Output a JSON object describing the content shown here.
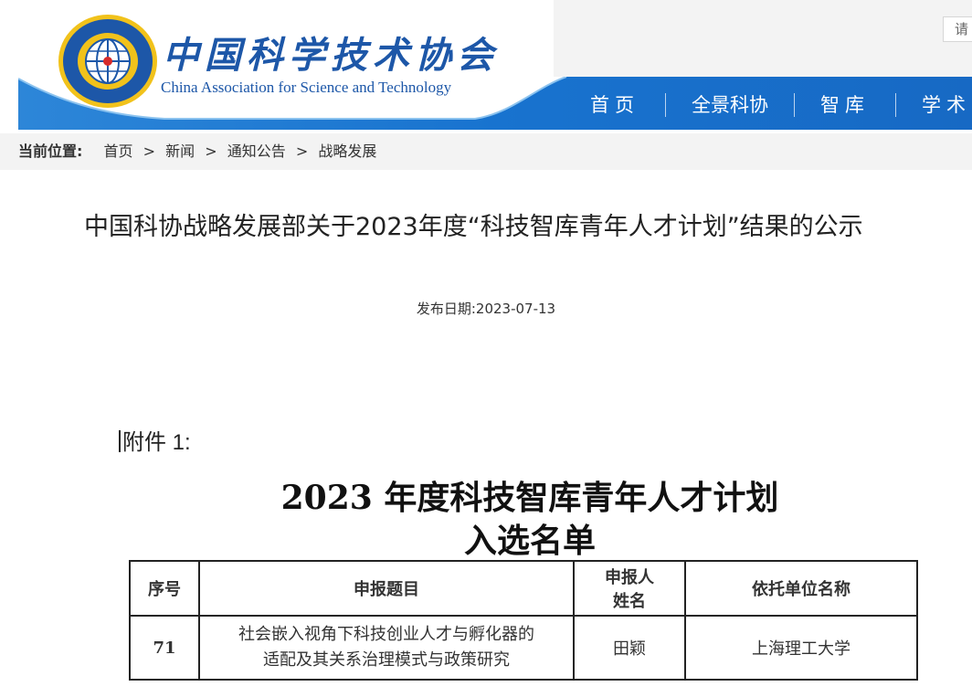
{
  "header": {
    "logo_cn": "中国科学技术协会",
    "logo_en": "China Association for Science and Technology",
    "search_placeholder": "请"
  },
  "nav": {
    "items": [
      "首页",
      "全景科协",
      "智库",
      "学术"
    ]
  },
  "breadcrumb": {
    "label": "当前位置:",
    "items": [
      "首页",
      "新闻",
      "通知公告",
      "战略发展"
    ],
    "separator": ">"
  },
  "article": {
    "title": "中国科协战略发展部关于2023年度“科技智库青年人才计划”结果的公示",
    "date": "发布日期:2023-07-13"
  },
  "attachment": {
    "label": "附件 1:",
    "title_line1": "2023 年度科技智库青年人才计划",
    "title_line2": "入选名单",
    "table": {
      "headers": [
        "序号",
        "申报题目",
        "申报人姓名",
        "依托单位名称"
      ],
      "header_name_line1": "申报人",
      "header_name_line2": "姓名",
      "rows": [
        {
          "no": "71",
          "topic_line1": "社会嵌入视角下科技创业人才与孵化器的",
          "topic_line2": "适配及其关系治理模式与政策研究",
          "name": "田颖",
          "org": "上海理工大学"
        }
      ]
    }
  },
  "colors": {
    "brand_blue": "#1d57a8",
    "nav_band": "#1873cf",
    "breadcrumb_bg": "#f3f3f3"
  }
}
